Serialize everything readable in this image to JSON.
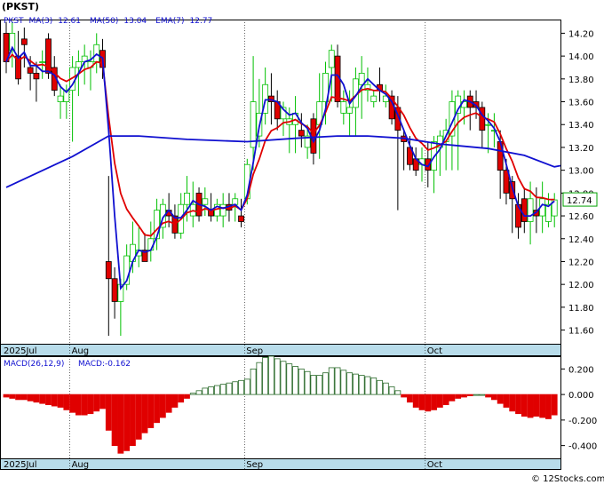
{
  "chart_data": [
    {
      "type": "candlestick",
      "title": "(PKST)",
      "legend": [
        {
          "label": "PKST",
          "color": "#1010d0"
        },
        {
          "label": "MA(3)",
          "value": "12.61",
          "color": "#1010d0"
        },
        {
          "label": "MA(50)",
          "value": "13.04",
          "color": "#1010d0"
        },
        {
          "label": "EMA(7)",
          "value": "12.77",
          "color": "#1010d0"
        }
      ],
      "last_price": "12.74",
      "ylim": [
        11.48,
        14.32
      ],
      "y_ticks": [
        "14.20",
        "14.00",
        "13.80",
        "13.60",
        "13.40",
        "13.20",
        "13.00",
        "12.80",
        "12.60",
        "12.40",
        "12.20",
        "12.00",
        "11.80",
        "11.60"
      ],
      "x_labels": [
        {
          "label": "2025Jul",
          "index": 0
        },
        {
          "label": "Aug",
          "index": 11
        },
        {
          "label": "Sep",
          "index": 40
        },
        {
          "label": "Oct",
          "index": 70
        }
      ],
      "candles": [
        [
          14.2,
          14.3,
          13.85,
          13.95
        ],
        [
          14.05,
          14.3,
          13.9,
          14.2
        ],
        [
          14.0,
          14.22,
          13.75,
          13.8
        ],
        [
          14.15,
          14.25,
          13.9,
          14.1
        ],
        [
          13.9,
          14.0,
          13.7,
          13.85
        ],
        [
          13.85,
          13.95,
          13.6,
          13.8
        ],
        [
          13.95,
          14.05,
          13.8,
          13.95
        ],
        [
          14.15,
          14.2,
          13.8,
          13.85
        ],
        [
          13.9,
          14.0,
          13.65,
          13.7
        ],
        [
          13.6,
          13.75,
          13.45,
          13.65
        ],
        [
          13.6,
          13.75,
          13.45,
          13.7
        ],
        [
          13.7,
          14.0,
          13.25,
          13.9
        ],
        [
          13.9,
          14.05,
          13.65,
          13.95
        ],
        [
          13.95,
          14.1,
          13.75,
          14.0
        ],
        [
          13.9,
          14.05,
          13.7,
          13.95
        ],
        [
          13.95,
          14.2,
          13.85,
          14.1
        ],
        [
          14.05,
          14.15,
          13.8,
          13.9
        ],
        [
          12.2,
          12.95,
          11.55,
          12.05
        ],
        [
          12.05,
          12.15,
          11.7,
          11.85
        ],
        [
          11.85,
          12.05,
          11.55,
          12.0
        ],
        [
          12.0,
          12.35,
          11.95,
          12.25
        ],
        [
          12.2,
          12.55,
          12.1,
          12.35
        ],
        [
          12.25,
          12.5,
          12.15,
          12.3
        ],
        [
          12.3,
          12.45,
          12.2,
          12.2
        ],
        [
          12.3,
          12.55,
          12.2,
          12.4
        ],
        [
          12.4,
          12.75,
          12.3,
          12.65
        ],
        [
          12.5,
          12.75,
          12.4,
          12.7
        ],
        [
          12.65,
          12.8,
          12.5,
          12.6
        ],
        [
          12.6,
          12.7,
          12.4,
          12.45
        ],
        [
          12.45,
          12.8,
          12.4,
          12.7
        ],
        [
          12.7,
          12.95,
          12.55,
          12.8
        ],
        [
          12.6,
          12.9,
          12.5,
          12.7
        ],
        [
          12.8,
          12.85,
          12.55,
          12.6
        ],
        [
          12.7,
          12.85,
          12.6,
          12.75
        ],
        [
          12.65,
          12.8,
          12.55,
          12.6
        ],
        [
          12.6,
          12.75,
          12.55,
          12.7
        ],
        [
          12.6,
          12.8,
          12.5,
          12.7
        ],
        [
          12.7,
          12.8,
          12.55,
          12.65
        ],
        [
          12.7,
          12.8,
          12.55,
          12.75
        ],
        [
          12.6,
          12.75,
          12.5,
          12.55
        ],
        [
          12.75,
          13.1,
          12.7,
          13.05
        ],
        [
          13.2,
          14.0,
          13.0,
          13.6
        ],
        [
          13.3,
          13.8,
          13.2,
          13.5
        ],
        [
          13.5,
          13.9,
          13.4,
          13.75
        ],
        [
          13.65,
          13.85,
          13.4,
          13.6
        ],
        [
          13.6,
          13.7,
          13.35,
          13.45
        ],
        [
          13.45,
          13.6,
          13.3,
          13.55
        ],
        [
          13.4,
          13.55,
          13.15,
          13.45
        ],
        [
          13.4,
          13.65,
          13.15,
          13.5
        ],
        [
          13.35,
          13.5,
          13.2,
          13.3
        ],
        [
          13.2,
          13.4,
          13.1,
          13.3
        ],
        [
          13.45,
          13.5,
          13.05,
          13.15
        ],
        [
          13.4,
          13.85,
          13.1,
          13.6
        ],
        [
          13.6,
          13.95,
          13.4,
          13.85
        ],
        [
          13.9,
          14.1,
          13.6,
          14.05
        ],
        [
          14.0,
          14.1,
          13.55,
          13.6
        ],
        [
          13.5,
          13.7,
          13.4,
          13.6
        ],
        [
          13.5,
          13.7,
          13.3,
          13.55
        ],
        [
          13.55,
          13.9,
          13.3,
          13.8
        ],
        [
          13.75,
          14.0,
          13.45,
          13.85
        ],
        [
          13.7,
          13.9,
          13.6,
          13.75
        ],
        [
          13.6,
          13.7,
          13.55,
          13.65
        ],
        [
          13.75,
          13.9,
          13.6,
          13.7
        ],
        [
          13.6,
          13.75,
          13.55,
          13.65
        ],
        [
          13.65,
          13.7,
          13.4,
          13.45
        ],
        [
          13.55,
          13.65,
          12.65,
          13.35
        ],
        [
          13.3,
          13.35,
          13.0,
          13.25
        ],
        [
          13.2,
          13.3,
          13.0,
          13.05
        ],
        [
          13.1,
          13.2,
          12.95,
          13.0
        ],
        [
          13.05,
          13.2,
          12.9,
          13.1
        ],
        [
          13.1,
          13.25,
          12.85,
          13.0
        ],
        [
          13.0,
          13.3,
          12.8,
          13.25
        ],
        [
          13.2,
          13.35,
          12.95,
          13.3
        ],
        [
          13.25,
          13.45,
          13.0,
          13.35
        ],
        [
          13.3,
          13.7,
          13.0,
          13.6
        ],
        [
          13.5,
          13.7,
          13.0,
          13.65
        ],
        [
          13.55,
          13.7,
          13.4,
          13.6
        ],
        [
          13.65,
          13.7,
          13.35,
          13.55
        ],
        [
          13.6,
          13.7,
          13.45,
          13.55
        ],
        [
          13.55,
          13.6,
          13.2,
          13.35
        ],
        [
          13.4,
          13.5,
          13.15,
          13.4
        ],
        [
          13.35,
          13.5,
          13.2,
          13.35
        ],
        [
          13.25,
          13.35,
          12.75,
          13.0
        ],
        [
          13.0,
          13.1,
          12.7,
          12.8
        ],
        [
          12.9,
          12.95,
          12.45,
          12.75
        ],
        [
          12.7,
          12.8,
          12.4,
          12.5
        ],
        [
          12.75,
          12.85,
          12.45,
          12.55
        ],
        [
          12.55,
          12.9,
          12.35,
          12.75
        ],
        [
          12.65,
          12.85,
          12.45,
          12.6
        ],
        [
          12.6,
          12.9,
          12.45,
          12.75
        ],
        [
          12.55,
          12.8,
          12.5,
          12.7
        ],
        [
          12.6,
          12.8,
          12.5,
          12.74
        ]
      ],
      "ma50": [
        [
          0,
          12.85
        ],
        [
          11,
          13.12
        ],
        [
          17,
          13.3
        ],
        [
          22,
          13.3
        ],
        [
          30,
          13.27
        ],
        [
          40,
          13.25
        ],
        [
          48,
          13.28
        ],
        [
          55,
          13.3
        ],
        [
          60,
          13.3
        ],
        [
          66,
          13.28
        ],
        [
          72,
          13.23
        ],
        [
          80,
          13.19
        ],
        [
          86,
          13.13
        ],
        [
          91,
          13.03
        ],
        [
          92,
          13.04
        ]
      ],
      "macd": {
        "label": "MACD(26,12,9)",
        "value_label": "MACD:-0.162",
        "ylim": [
          -0.5,
          0.3
        ],
        "y_ticks": [
          "0.200",
          "0.000",
          "-0.200",
          "-0.400"
        ],
        "hist": [
          -0.02,
          -0.03,
          -0.04,
          -0.04,
          -0.05,
          -0.06,
          -0.07,
          -0.08,
          -0.09,
          -0.1,
          -0.12,
          -0.14,
          -0.16,
          -0.16,
          -0.15,
          -0.13,
          -0.11,
          -0.28,
          -0.4,
          -0.46,
          -0.44,
          -0.4,
          -0.35,
          -0.3,
          -0.26,
          -0.22,
          -0.18,
          -0.14,
          -0.1,
          -0.06,
          -0.03,
          0.01,
          0.03,
          0.05,
          0.06,
          0.07,
          0.08,
          0.09,
          0.1,
          0.11,
          0.12,
          0.2,
          0.25,
          0.29,
          0.3,
          0.28,
          0.26,
          0.24,
          0.22,
          0.2,
          0.18,
          0.15,
          0.15,
          0.17,
          0.21,
          0.21,
          0.19,
          0.17,
          0.16,
          0.15,
          0.14,
          0.13,
          0.11,
          0.09,
          0.06,
          0.03,
          -0.02,
          -0.06,
          -0.1,
          -0.12,
          -0.13,
          -0.12,
          -0.1,
          -0.08,
          -0.05,
          -0.03,
          -0.02,
          -0.01,
          0.0,
          0.0,
          -0.02,
          -0.04,
          -0.07,
          -0.1,
          -0.13,
          -0.15,
          -0.17,
          -0.18,
          -0.17,
          -0.18,
          -0.19,
          -0.16
        ]
      },
      "credit": "© 12Stocks.com",
      "colors": {
        "up": "#00c000",
        "down": "#e00000",
        "ma_short": "#1010d0",
        "ma_long": "#1010d0",
        "ema": "#e00000",
        "x_band": "#b8dcea",
        "grid": "#000000"
      }
    }
  ]
}
